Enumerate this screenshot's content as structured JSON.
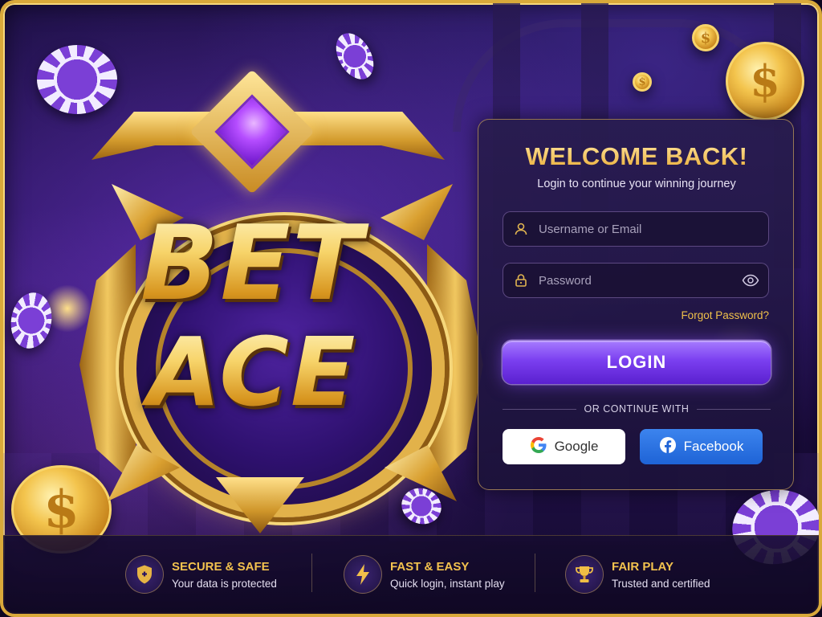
{
  "logo": {
    "line1": "BET",
    "line2": "ACE"
  },
  "login": {
    "title": "WELCOME BACK!",
    "subtitle": "Login to continue your winning journey",
    "username_placeholder": "Username or Email",
    "password_placeholder": "Password",
    "forgot": "Forgot Password?",
    "login_button": "LOGIN",
    "divider": "OR CONTINUE WITH",
    "google": "Google",
    "facebook": "Facebook"
  },
  "features": [
    {
      "title": "SECURE & SAFE",
      "desc": "Your data is protected",
      "icon": "shield-icon"
    },
    {
      "title": "FAST & EASY",
      "desc": "Quick login, instant play",
      "icon": "lightning-icon"
    },
    {
      "title": "FAIR PLAY",
      "desc": "Trusted and certified",
      "icon": "trophy-icon"
    }
  ],
  "colors": {
    "gold": "#f3c24e",
    "purple": "#7b3ff0",
    "facebook": "#1e63d6"
  }
}
